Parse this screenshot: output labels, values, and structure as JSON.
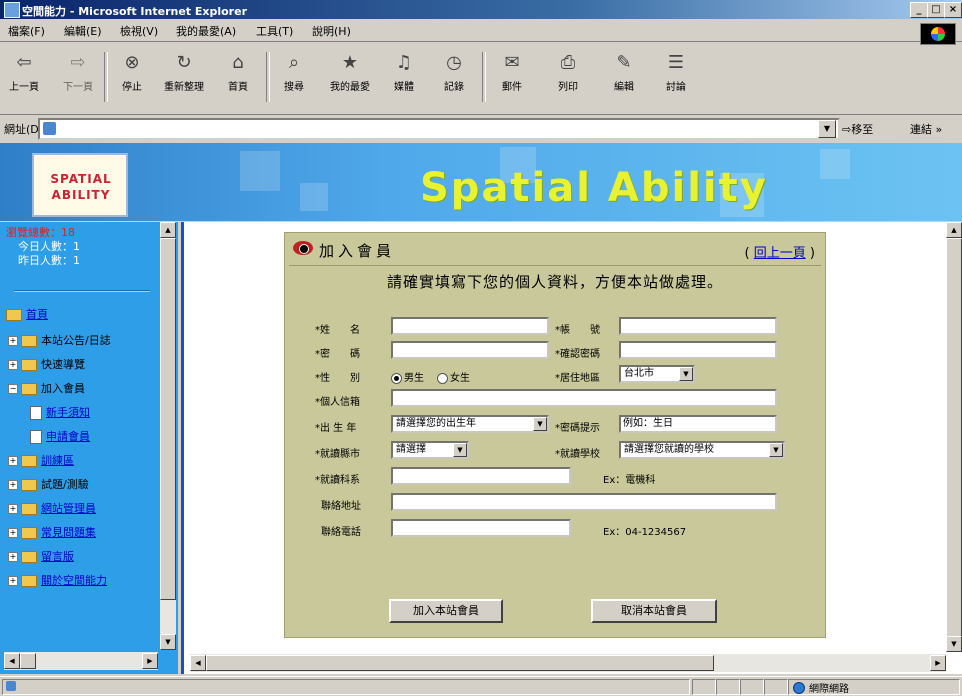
{
  "window": {
    "title": "空間能力 - Microsoft Internet Explorer",
    "controls": [
      "_",
      "□",
      "×"
    ]
  },
  "menu": [
    "檔案(F)",
    "編輯(E)",
    "檢視(V)",
    "我的最愛(A)",
    "工具(T)",
    "說明(H)"
  ],
  "toolbar": [
    {
      "label": "上一頁",
      "icon": "back-arrow-icon"
    },
    {
      "label": "下一頁",
      "icon": "forward-arrow-icon"
    },
    {
      "label": "停止",
      "icon": "stop-icon"
    },
    {
      "label": "重新整理",
      "icon": "refresh-icon"
    },
    {
      "label": "首頁",
      "icon": "home-icon"
    },
    {
      "label": "搜尋",
      "icon": "search-icon"
    },
    {
      "label": "我的最愛",
      "icon": "favorites-icon"
    },
    {
      "label": "媒體",
      "icon": "media-icon"
    },
    {
      "label": "記錄",
      "icon": "history-icon"
    },
    {
      "label": "郵件",
      "icon": "mail-icon"
    },
    {
      "label": "列印",
      "icon": "print-icon"
    },
    {
      "label": "編輯",
      "icon": "edit-icon"
    },
    {
      "label": "討論",
      "icon": "discuss-icon"
    }
  ],
  "address": {
    "label": "網址(D)",
    "value": "",
    "go": "移至",
    "links": "連結 »"
  },
  "banner": {
    "logo_text": "SPATIAL ABILITY",
    "title": "Spatial  Ability"
  },
  "sidebar": {
    "stats": [
      "瀏覽總數：18",
      "今日人數：1",
      "昨日人數：1"
    ],
    "items": [
      {
        "label": "首頁",
        "link": true,
        "level": 0
      },
      {
        "label": "本站公告/日誌",
        "link": false,
        "level": 1
      },
      {
        "label": "快速導覽",
        "link": false,
        "level": 1
      },
      {
        "label": "加入會員",
        "link": false,
        "level": 1
      },
      {
        "label": "新手須知",
        "link": true,
        "level": 2
      },
      {
        "label": "申請會員",
        "link": true,
        "level": 2
      },
      {
        "label": "訓練區",
        "link": true,
        "level": 1
      },
      {
        "label": "試題/測驗",
        "link": false,
        "level": 1
      },
      {
        "label": "網站管理員",
        "link": true,
        "level": 1
      },
      {
        "label": "常見問題集",
        "link": true,
        "level": 1
      },
      {
        "label": "留言版",
        "link": true,
        "level": 1
      },
      {
        "label": "關於空間能力",
        "link": true,
        "level": 1
      }
    ]
  },
  "form": {
    "title": "加入會員",
    "back_link": "回上一頁",
    "instruction": "請確實填寫下您的個人資料，方便本站做處理。",
    "fields": {
      "name": {
        "label": "*姓　　名",
        "value": ""
      },
      "account": {
        "label": "*帳　　號",
        "value": ""
      },
      "password": {
        "label": "*密　　碼",
        "value": ""
      },
      "confirm_password": {
        "label": "*確認密碼",
        "value": ""
      },
      "gender": {
        "label": "*性　　別",
        "options": [
          "男生",
          "女生"
        ],
        "selected": "男生"
      },
      "region": {
        "label": "*居住地區",
        "value": "台北市"
      },
      "email": {
        "label": "*個人信箱",
        "value": ""
      },
      "birth_year": {
        "label": "*出 生 年",
        "value": "請選擇您的出生年"
      },
      "password_hint": {
        "label": "*密碼提示",
        "value": "例如：生日"
      },
      "school_city": {
        "label": "*就讀縣市",
        "value": "請選擇"
      },
      "school": {
        "label": "*就讀學校",
        "value": "請選擇您就讀的學校"
      },
      "department": {
        "label": "*就讀科系",
        "value": "",
        "hint": "Ex：電機科"
      },
      "address": {
        "label": "聯絡地址",
        "value": ""
      },
      "phone": {
        "label": "聯絡電話",
        "value": "",
        "hint": "Ex：04-1234567"
      }
    },
    "submit": "加入本站會員",
    "cancel": "取消本站會員"
  },
  "status": {
    "zone": "網際網路"
  }
}
